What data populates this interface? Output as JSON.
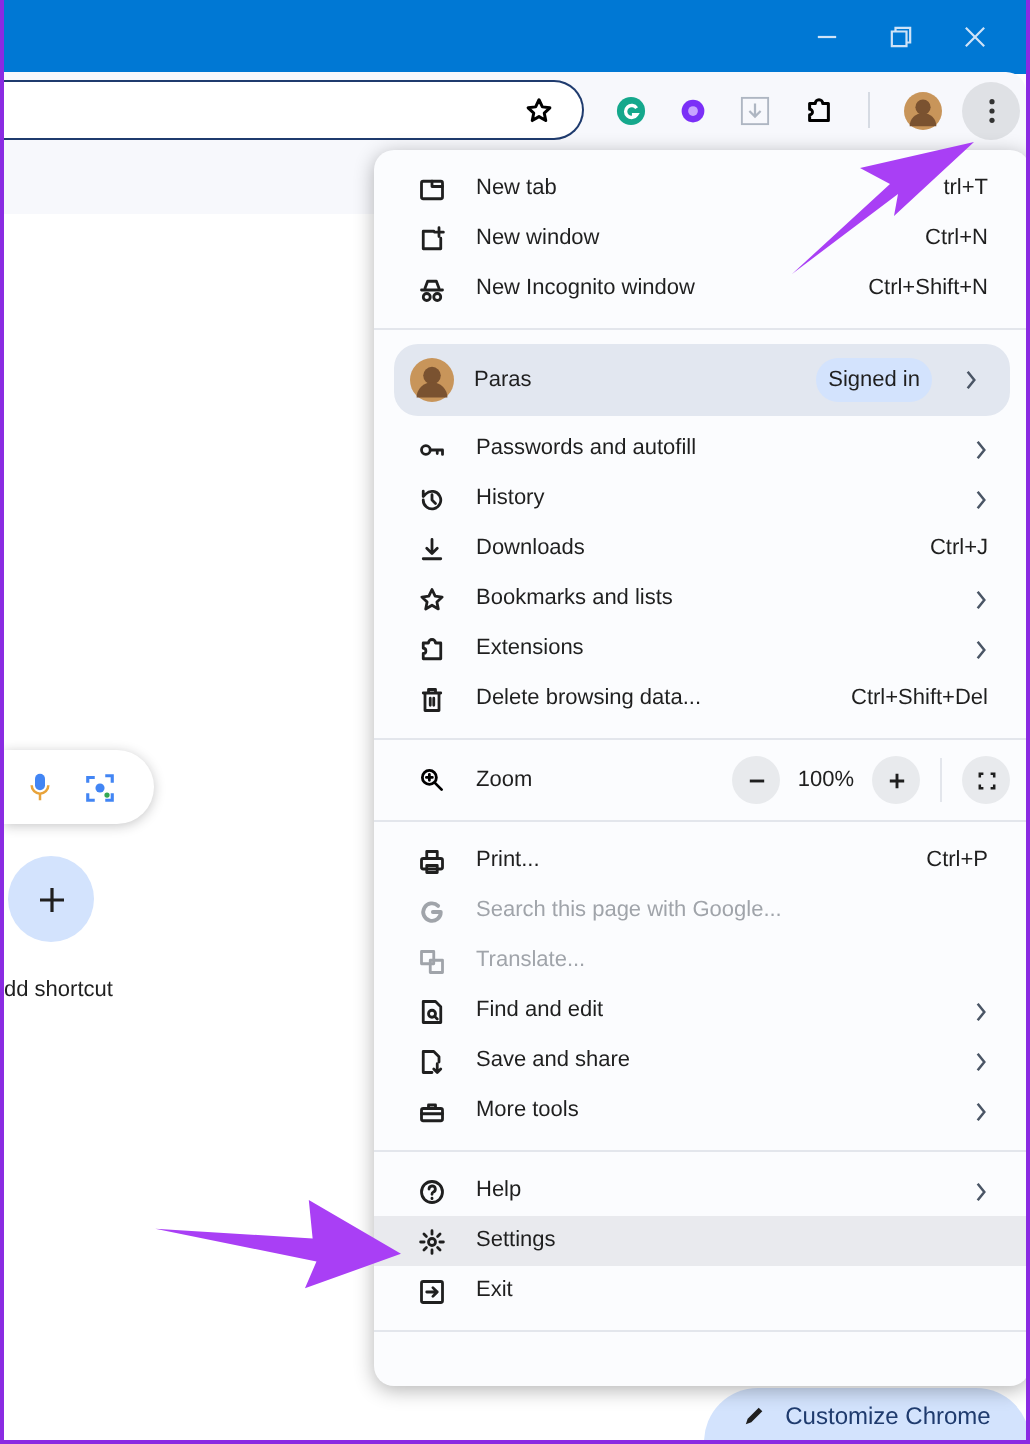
{
  "page": {
    "shortcut_label": "dd shortcut",
    "customize_button": "Customize Chrome"
  },
  "menu": {
    "items": [
      {
        "kind": "item",
        "label": "New tab",
        "shortcut": "trl+T",
        "submenu": false,
        "disabled": false,
        "highlighted": false
      },
      {
        "kind": "item",
        "label": "New window",
        "shortcut": "Ctrl+N",
        "submenu": false,
        "disabled": false,
        "highlighted": false
      },
      {
        "kind": "item",
        "label": "New Incognito window",
        "shortcut": "Ctrl+Shift+N",
        "submenu": false,
        "disabled": false,
        "highlighted": false
      },
      {
        "kind": "separator"
      },
      {
        "kind": "profile",
        "label": "Paras",
        "badge": "Signed in",
        "submenu": true
      },
      {
        "kind": "item",
        "label": "Passwords and autofill",
        "submenu": true,
        "disabled": false,
        "highlighted": false
      },
      {
        "kind": "item",
        "label": "History",
        "submenu": true,
        "disabled": false,
        "highlighted": false
      },
      {
        "kind": "item",
        "label": "Downloads",
        "shortcut": "Ctrl+J",
        "submenu": false,
        "disabled": false,
        "highlighted": false
      },
      {
        "kind": "item",
        "label": "Bookmarks and lists",
        "submenu": true,
        "disabled": false,
        "highlighted": false
      },
      {
        "kind": "item",
        "label": "Extensions",
        "submenu": true,
        "disabled": false,
        "highlighted": false
      },
      {
        "kind": "item",
        "label": "Delete browsing data...",
        "shortcut": "Ctrl+Shift+Del",
        "submenu": false,
        "disabled": false,
        "highlighted": false
      },
      {
        "kind": "separator"
      },
      {
        "kind": "zoom",
        "label": "Zoom",
        "value": "100%"
      },
      {
        "kind": "separator"
      },
      {
        "kind": "item",
        "label": "Print...",
        "shortcut": "Ctrl+P",
        "submenu": false,
        "disabled": false,
        "highlighted": false
      },
      {
        "kind": "item",
        "label": "Search this page with Google...",
        "submenu": false,
        "disabled": true,
        "highlighted": false
      },
      {
        "kind": "item",
        "label": "Translate...",
        "submenu": false,
        "disabled": true,
        "highlighted": false
      },
      {
        "kind": "item",
        "label": "Find and edit",
        "submenu": true,
        "disabled": false,
        "highlighted": false
      },
      {
        "kind": "item",
        "label": "Save and share",
        "submenu": true,
        "disabled": false,
        "highlighted": false
      },
      {
        "kind": "item",
        "label": "More tools",
        "submenu": true,
        "disabled": false,
        "highlighted": false
      },
      {
        "kind": "separator"
      },
      {
        "kind": "item",
        "label": "Help",
        "submenu": true,
        "disabled": false,
        "highlighted": false
      },
      {
        "kind": "item",
        "label": "Settings",
        "submenu": false,
        "disabled": false,
        "highlighted": true
      },
      {
        "kind": "item",
        "label": "Exit",
        "submenu": false,
        "disabled": false,
        "highlighted": false
      },
      {
        "kind": "separator"
      }
    ]
  }
}
